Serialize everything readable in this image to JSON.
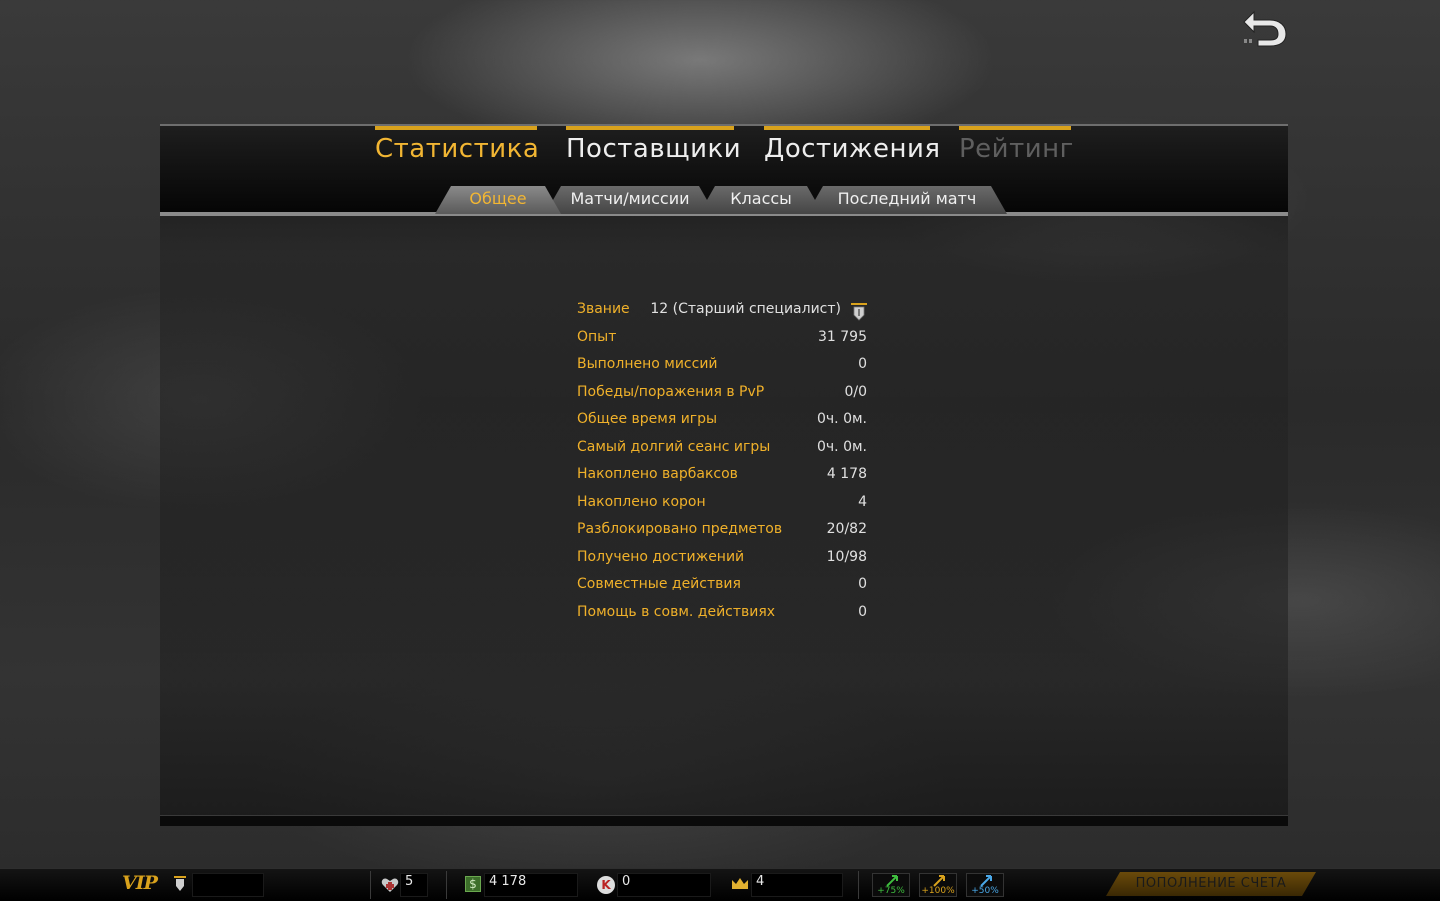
{
  "main_tabs": [
    {
      "label": "Статистика",
      "state": "active"
    },
    {
      "label": "Поставщики",
      "state": "normal"
    },
    {
      "label": "Достижения",
      "state": "normal"
    },
    {
      "label": "Рейтинг",
      "state": "disabled"
    }
  ],
  "sub_tabs": [
    {
      "label": "Общее",
      "state": "active"
    },
    {
      "label": "Матчи/миссии",
      "state": "normal"
    },
    {
      "label": "Классы",
      "state": "normal"
    },
    {
      "label": "Последний матч",
      "state": "normal"
    }
  ],
  "stats": {
    "rank": {
      "label": "Звание",
      "value": "12 (Старший специалист)"
    },
    "rows": [
      {
        "label": "Опыт",
        "value": "31 795"
      },
      {
        "label": "Выполнено миссий",
        "value": "0"
      },
      {
        "label": "Победы/поражения в PvP",
        "value": "0/0"
      },
      {
        "label": "Общее время игры",
        "value": "0ч. 0м."
      },
      {
        "label": "Самый долгий сеанс игры",
        "value": "0ч. 0м."
      },
      {
        "label": "Накоплено варбаксов",
        "value": "4 178"
      },
      {
        "label": "Накоплено корон",
        "value": "4"
      },
      {
        "label": "Разблокировано предметов",
        "value": "20/82"
      },
      {
        "label": "Получено достижений",
        "value": "10/98"
      },
      {
        "label": "Совместные действия",
        "value": "0"
      },
      {
        "label": "Помощь в совм. действиях",
        "value": "0"
      }
    ]
  },
  "bottom_bar": {
    "vip_label": "VIP",
    "health_count": "5",
    "warbucks": "4 178",
    "kredits": "0",
    "crowns": "4",
    "boosts": [
      {
        "label": "+75%",
        "color": "#3fbf3f"
      },
      {
        "label": "+100%",
        "color": "#d9a21c"
      },
      {
        "label": "+50%",
        "color": "#4aa8e8"
      }
    ],
    "topup_label": "ПОПОЛНЕНИЕ СЧЕТА"
  },
  "colors": {
    "accent": "#f2b633",
    "tab_border": "#d9a21c"
  }
}
